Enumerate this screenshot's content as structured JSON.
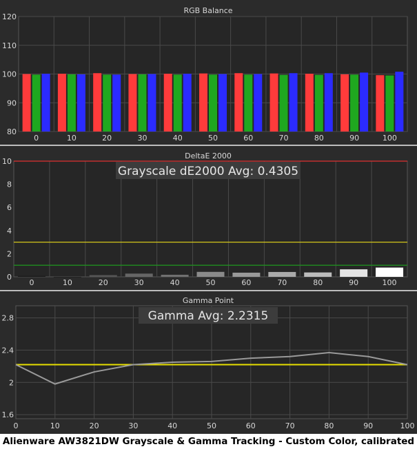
{
  "caption": "Alienware AW3821DW Grayscale & Gamma Tracking - Custom Color, calibrated",
  "chart_data": [
    {
      "type": "bar",
      "title": "RGB Balance",
      "categories": [
        "0",
        "10",
        "20",
        "30",
        "40",
        "50",
        "60",
        "70",
        "80",
        "90",
        "100"
      ],
      "ylim": [
        80,
        120
      ],
      "yticks": [
        80,
        90,
        100,
        110,
        120
      ],
      "grid": true,
      "series": [
        {
          "color": "#ff3b3b",
          "values": [
            100.0,
            100.1,
            100.3,
            100.0,
            100.1,
            100.2,
            100.3,
            100.2,
            100.1,
            99.9,
            99.6
          ]
        },
        {
          "color": "#1fa81f",
          "values": [
            99.8,
            99.9,
            99.8,
            99.9,
            99.8,
            99.8,
            99.8,
            99.7,
            99.7,
            99.8,
            99.5
          ]
        },
        {
          "color": "#2b2bff",
          "values": [
            100.1,
            99.9,
            99.8,
            100.0,
            100.1,
            100.0,
            100.0,
            100.3,
            100.3,
            100.5,
            100.8
          ]
        }
      ]
    },
    {
      "type": "bar",
      "title": "DeltaE 2000",
      "categories": [
        "0",
        "10",
        "20",
        "30",
        "40",
        "50",
        "60",
        "70",
        "80",
        "90",
        "100"
      ],
      "ylim": [
        0,
        10
      ],
      "yticks": [
        0,
        2,
        4,
        6,
        8,
        10
      ],
      "values": [
        0.08,
        0.0,
        0.15,
        0.28,
        0.18,
        0.43,
        0.36,
        0.42,
        0.38,
        0.65,
        0.8
      ],
      "bar_colors": [
        "#1a1a1a",
        "#1a1a1a",
        "#555555",
        "#666666",
        "#707070",
        "#8a8a8a",
        "#999999",
        "#aaaaaa",
        "#bbbbbb",
        "#e4e4e4",
        "#ffffff"
      ],
      "reference_lines": [
        {
          "value": 3,
          "color": "#d4c81a"
        },
        {
          "value": 1,
          "color": "#1f8f1f"
        },
        {
          "value": 10,
          "color": "#e03030"
        }
      ],
      "annotation": "Grayscale dE2000 Avg: 0.4305"
    },
    {
      "type": "line",
      "title": "Gamma Point",
      "x": [
        0,
        10,
        20,
        30,
        40,
        50,
        60,
        70,
        80,
        90,
        100
      ],
      "values": [
        2.22,
        1.98,
        2.13,
        2.22,
        2.25,
        2.26,
        2.3,
        2.32,
        2.37,
        2.32,
        2.22
      ],
      "line_color": "#9a9a9a",
      "xlim": [
        0,
        100
      ],
      "ylim": [
        1.55,
        2.95
      ],
      "yticks": [
        1.6,
        2,
        2.4,
        2.8
      ],
      "reference_line": {
        "value": 2.22,
        "color": "#e8e000"
      },
      "annotation": "Gamma Avg: 2.2315"
    }
  ]
}
